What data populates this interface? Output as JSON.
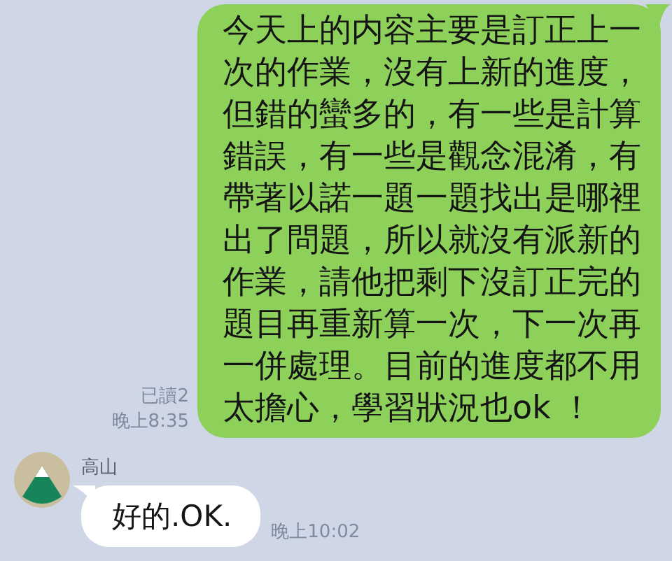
{
  "messages": [
    {
      "kind": "outgoing",
      "text": "今天上的内容主要是訂正上一次的作業，沒有上新的進度，但錯的蠻多的，有一些是計算錯誤，有一些是觀念混淆，有帶著以諾一題一題找出是哪裡出了問題，所以就沒有派新的作業，請他把剩下沒訂正完的題目再重新算一次，下一次再一併處理。目前的進度都不用太擔心，學習狀況也ok ！",
      "read_receipt": "已讀2",
      "time": "晚上8:35"
    },
    {
      "kind": "incoming",
      "sender": "高山",
      "text": "好的.OK.",
      "time": "晚上10:02"
    }
  ]
}
